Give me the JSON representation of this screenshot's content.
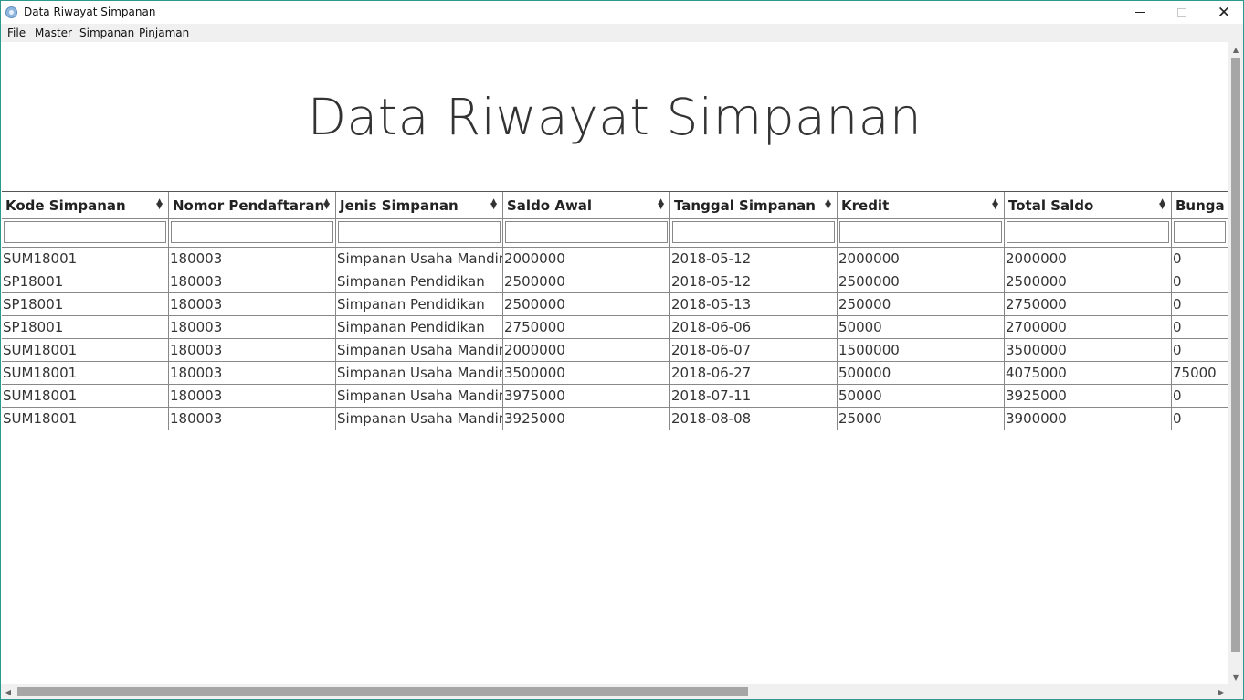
{
  "window": {
    "title": "Data Riwayat Simpanan",
    "minimize": "minimize",
    "maximize": "maximize",
    "close": "✕"
  },
  "menu": [
    "File",
    "Master",
    "Simpanan",
    "Pinjaman"
  ],
  "page": {
    "heading": "Data Riwayat Simpanan"
  },
  "table": {
    "columns": [
      "Kode Simpanan",
      "Nomor Pendaftaran",
      "Jenis Simpanan",
      "Saldo Awal",
      "Tanggal Simpanan",
      "Kredit",
      "Total Saldo",
      "Bunga"
    ],
    "rows": [
      [
        "SUM18001",
        "180003",
        "Simpanan Usaha Mandiri",
        "2000000",
        "2018-05-12",
        "2000000",
        "2000000",
        "0"
      ],
      [
        "SP18001",
        "180003",
        "Simpanan Pendidikan",
        "2500000",
        "2018-05-12",
        "2500000",
        "2500000",
        "0"
      ],
      [
        "SP18001",
        "180003",
        "Simpanan Pendidikan",
        "2500000",
        "2018-05-13",
        "250000",
        "2750000",
        "0"
      ],
      [
        "SP18001",
        "180003",
        "Simpanan Pendidikan",
        "2750000",
        "2018-06-06",
        "50000",
        "2700000",
        "0"
      ],
      [
        "SUM18001",
        "180003",
        "Simpanan Usaha Mandiri",
        "2000000",
        "2018-06-07",
        "1500000",
        "3500000",
        "0"
      ],
      [
        "SUM18001",
        "180003",
        "Simpanan Usaha Mandiri",
        "3500000",
        "2018-06-27",
        "500000",
        "4075000",
        "75000"
      ],
      [
        "SUM18001",
        "180003",
        "Simpanan Usaha Mandiri",
        "3975000",
        "2018-07-11",
        "50000",
        "3925000",
        "0"
      ],
      [
        "SUM18001",
        "180003",
        "Simpanan Usaha Mandiri",
        "3925000",
        "2018-08-08",
        "25000",
        "3900000",
        "0"
      ]
    ]
  },
  "icons": {
    "app": "app-icon",
    "sort": "sort-icon",
    "scroll_up": "scroll-up-arrow-icon",
    "scroll_down": "scroll-down-arrow-icon",
    "scroll_left": "scroll-left-arrow-icon",
    "scroll_right": "scroll-right-arrow-icon"
  },
  "colors": {
    "window_border": "#2b9a8c",
    "menubar_bg": "#f0f0f0",
    "scroll_thumb": "#a6a6a6"
  }
}
